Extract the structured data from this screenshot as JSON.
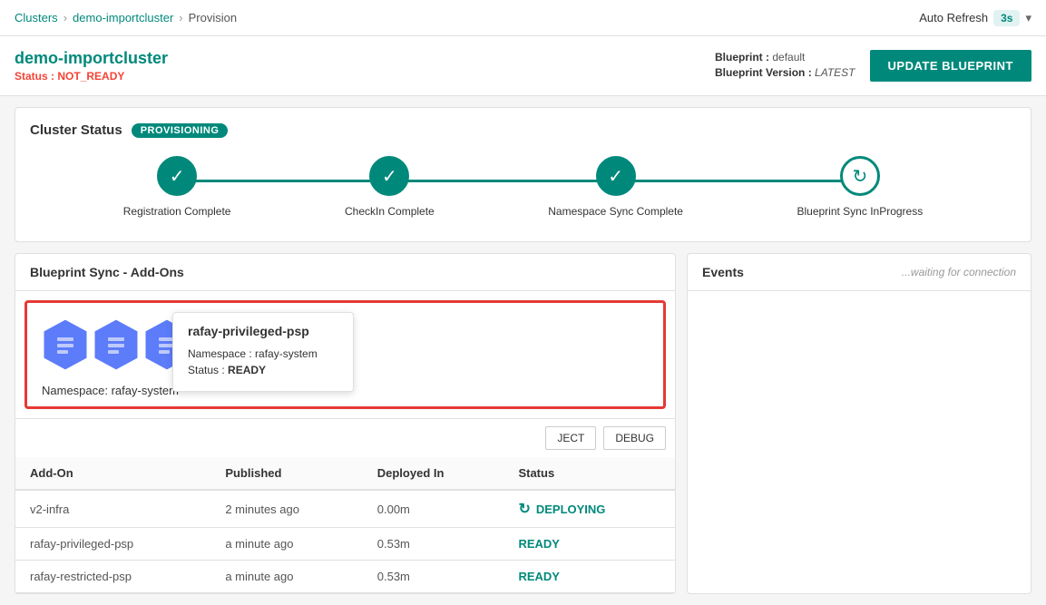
{
  "breadcrumb": {
    "clusters": "Clusters",
    "cluster": "demo-importcluster",
    "page": "Provision"
  },
  "autoRefresh": {
    "label": "Auto Refresh",
    "interval": "3s"
  },
  "clusterHeader": {
    "name": "demo-importcluster",
    "statusLabel": "Status :",
    "statusValue": "NOT_READY",
    "blueprintLabel": "Blueprint :",
    "blueprintValue": "default",
    "blueprintVersionLabel": "Blueprint Version :",
    "blueprintVersionValue": "LATEST",
    "updateButton": "UPDATE BLUEPRINT"
  },
  "clusterStatus": {
    "title": "Cluster Status",
    "badge": "PROVISIONING",
    "steps": [
      {
        "label": "Registration Complete",
        "state": "complete"
      },
      {
        "label": "CheckIn Complete",
        "state": "complete"
      },
      {
        "label": "Namespace Sync Complete",
        "state": "complete"
      },
      {
        "label": "Blueprint Sync InProgress",
        "state": "in-progress"
      }
    ]
  },
  "blueprintSync": {
    "title": "Blueprint Sync - Add-Ons",
    "namespaceLabel": "Namespace: rafay-system",
    "tooltip": {
      "name": "rafay-privileged-psp",
      "namespaceLabel": "Namespace :",
      "namespaceValue": "rafay-system",
      "statusLabel": "Status :",
      "statusValue": "READY"
    },
    "buttons": [
      {
        "label": "JECT"
      },
      {
        "label": "DEBUG"
      }
    ],
    "tableHeaders": [
      "Add-On",
      "Published",
      "Deployed In",
      "Status"
    ],
    "tableRows": [
      {
        "addon": "v2-infra",
        "published": "2 minutes ago",
        "deployedIn": "0.00m",
        "status": "DEPLOYING",
        "statusType": "deploying"
      },
      {
        "addon": "rafay-privileged-psp",
        "published": "a minute ago",
        "deployedIn": "0.53m",
        "status": "READY",
        "statusType": "ready"
      },
      {
        "addon": "rafay-restricted-psp",
        "published": "a minute ago",
        "deployedIn": "0.53m",
        "status": "READY",
        "statusType": "ready"
      }
    ]
  },
  "events": {
    "title": "Events",
    "waiting": "...waiting for connection"
  },
  "hexColors": {
    "blue": "#5c7cfa",
    "teal": "#00897b"
  }
}
